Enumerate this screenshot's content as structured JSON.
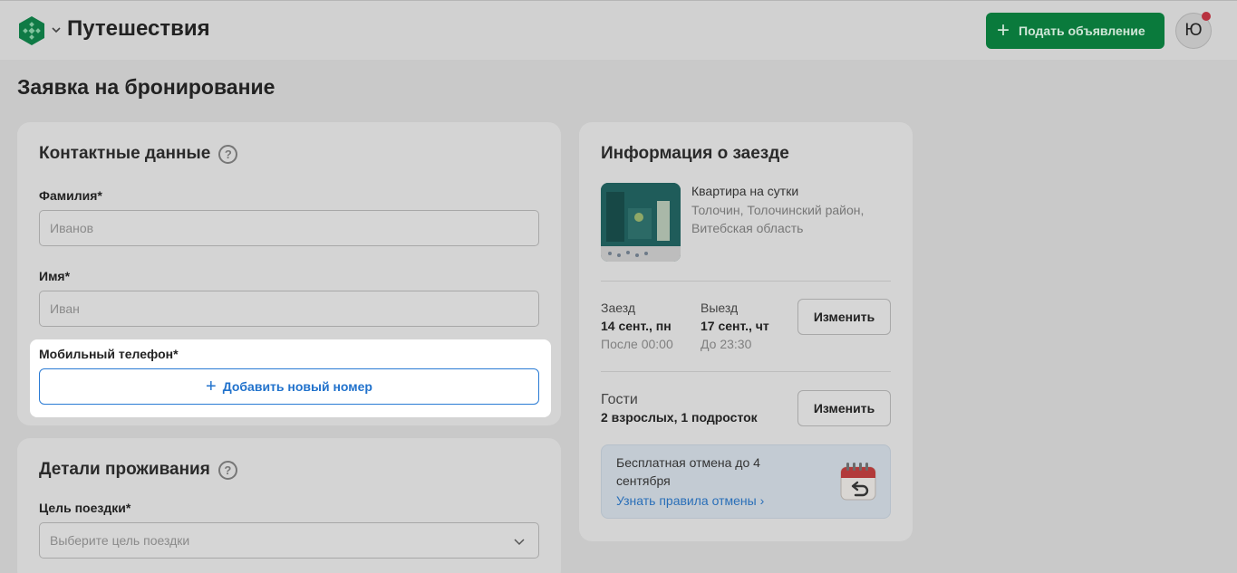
{
  "header": {
    "app_title": "Путешествия",
    "post_button": "Подать объявление",
    "avatar_letter": "Ю"
  },
  "page": {
    "title": "Заявка на бронирование"
  },
  "contacts": {
    "title": "Контактные данные",
    "help": "?",
    "last_name_label": "Фамилия*",
    "last_name_placeholder": "Иванов",
    "first_name_label": "Имя*",
    "first_name_placeholder": "Иван",
    "phone_label": "Мобильный телефон*",
    "add_phone": "Добавить новый номер"
  },
  "details": {
    "title": "Детали проживания",
    "help": "?",
    "purpose_label": "Цель поездки*",
    "purpose_placeholder": "Выберите цель поездки"
  },
  "info": {
    "title": "Информация о заезде",
    "property_name": "Квартира на сутки",
    "property_location": "Толочин, Толочинский район, Витебская область",
    "checkin_label": "Заезд",
    "checkin_date": "14 сент., пн",
    "checkin_time": "После 00:00",
    "checkout_label": "Выезд",
    "checkout_date": "17 сент., чт",
    "checkout_time": "До 23:30",
    "change_dates": "Изменить",
    "guests_label": "Гости",
    "guests_value": "2 взрослых, 1 подросток",
    "change_guests": "Изменить",
    "cancel_text": "Бесплатная отмена до 4 сентября",
    "cancel_link": "Узнать правила отмены ›"
  },
  "colors": {
    "brand_green": "#0a7a3c",
    "link_blue": "#2172cc",
    "notification_red": "#b8313f"
  }
}
